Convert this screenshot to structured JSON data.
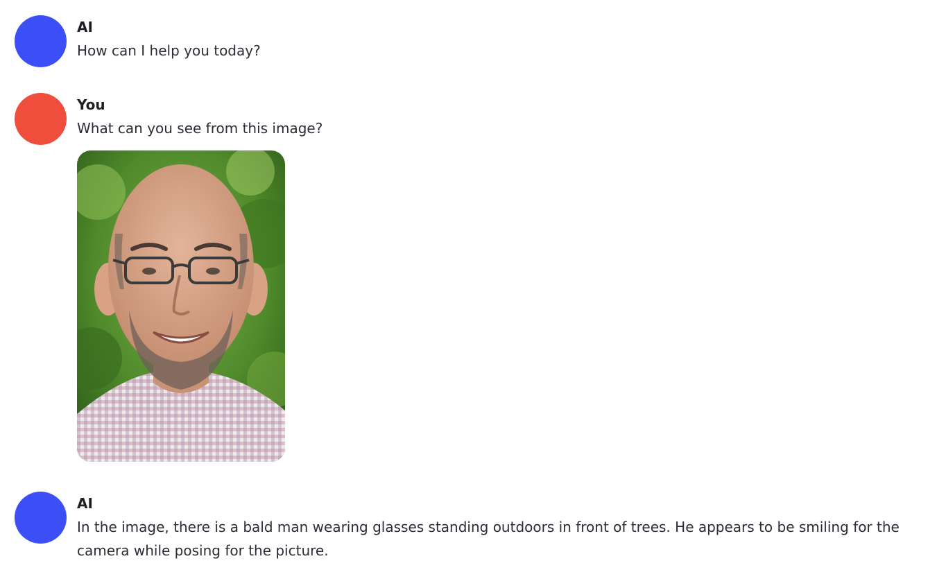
{
  "colors": {
    "ai_avatar": "#3c4ef5",
    "user_avatar": "#ef4e3c"
  },
  "messages": [
    {
      "sender": "AI",
      "role": "assistant",
      "text": "How can I help you today?"
    },
    {
      "sender": "You",
      "role": "user",
      "text": "What can you see from this image?",
      "attachment": "photo of a bald man with glasses and a beard, in a checkered shirt, in front of green trees"
    },
    {
      "sender": "AI",
      "role": "assistant",
      "text": "In the image, there is a bald man wearing glasses standing outdoors in front of trees. He appears to be smiling for the camera while posing for the picture."
    }
  ]
}
